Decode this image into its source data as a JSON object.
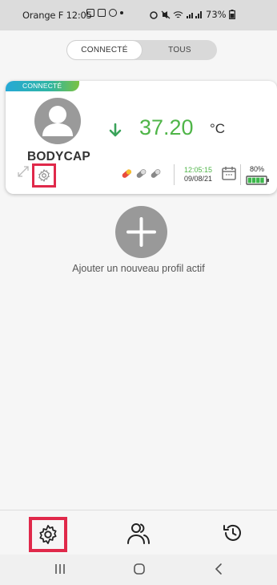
{
  "status_bar": {
    "carrier_time": "Orange F 12:05",
    "battery": "73%"
  },
  "tabs": [
    {
      "label": "CONNECTÉ",
      "active": true
    },
    {
      "label": "TOUS",
      "active": false
    }
  ],
  "profile": {
    "badge": "CONNECTÉ",
    "name": "BODYCAP",
    "temperature": "37.20",
    "unit": "°C",
    "trend": "down",
    "time": "12:05:15",
    "date": "09/08/21",
    "battery": "80%",
    "battery_level": 0.8
  },
  "add_profile": {
    "label": "Ajouter un nouveau profil actif"
  },
  "bottom_nav": [
    "settings-icon",
    "users-icon",
    "history-icon"
  ],
  "colors": {
    "accent_green": "#4fb548",
    "highlight_red": "#e0294a",
    "badge_blue": "#26a9d6"
  }
}
